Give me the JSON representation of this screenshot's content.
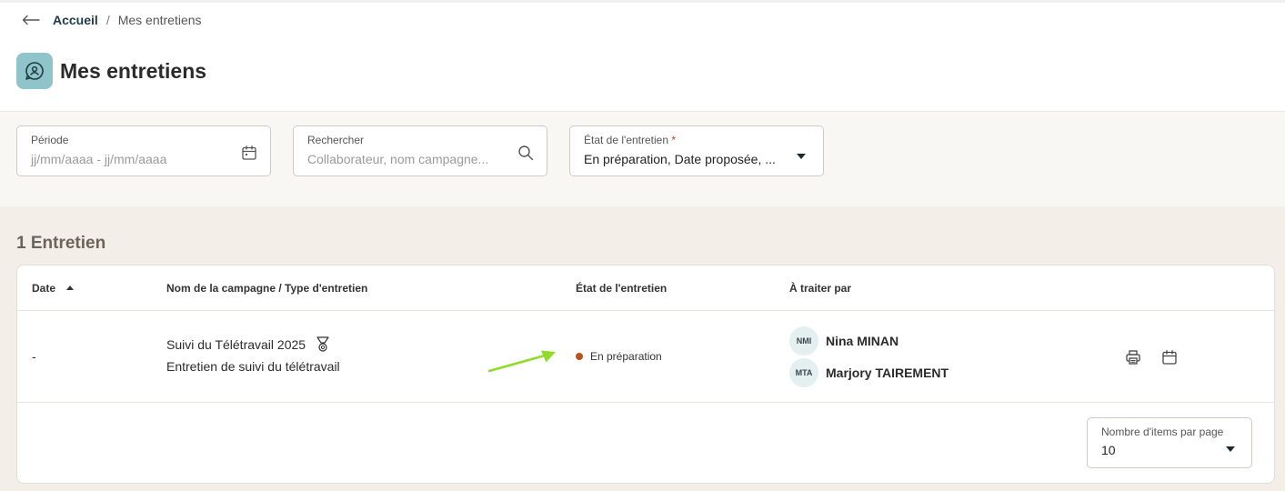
{
  "breadcrumb": {
    "home": "Accueil",
    "separator": "/",
    "current": "Mes entretiens"
  },
  "page": {
    "title": "Mes entretiens"
  },
  "filters": {
    "period": {
      "label": "Période",
      "placeholder": "jj/mm/aaaa - jj/mm/aaaa"
    },
    "search": {
      "label": "Rechercher",
      "placeholder": "Collaborateur, nom campagne..."
    },
    "state": {
      "label": "État de l'entretien",
      "required_mark": "*",
      "value": "En préparation, Date proposée, ..."
    }
  },
  "results": {
    "count_label": "1 Entretien"
  },
  "table": {
    "headers": {
      "date": "Date",
      "campaign": "Nom de la campagne / Type d'entretien",
      "state": "État de l'entretien",
      "assignees": "À traiter par"
    },
    "rows": [
      {
        "date": "-",
        "campaign_name": "Suivi du Télétravail 2025",
        "interview_type": "Entretien de suivi du télétravail",
        "status": "En préparation",
        "status_color": "#b5541c",
        "assignees": [
          {
            "initials": "NMI",
            "name": "Nina MINAN"
          },
          {
            "initials": "MTA",
            "name": "Marjory TAIREMENT"
          }
        ]
      }
    ]
  },
  "pagination": {
    "label": "Nombre d'items par page",
    "value": "10"
  },
  "colors": {
    "accent": "#8fc4cb",
    "annotation_arrow": "#8fdc2a",
    "filters_bg": "#f9f7f3",
    "results_bg": "#f3eee7"
  },
  "icons": {
    "back": "arrow-left-icon",
    "app": "chat-person-icon",
    "period": "calendar-icon",
    "search": "search-icon",
    "campaign_badge": "award-icon",
    "print": "printer-icon",
    "schedule": "calendar-icon"
  }
}
